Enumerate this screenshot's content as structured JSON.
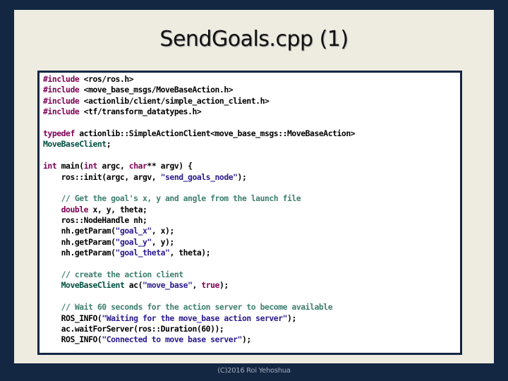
{
  "slide": {
    "title": "SendGoals.cpp (1)",
    "footer": "(C)2016 Roi Yehoshua"
  },
  "colors": {
    "frame_background": "#132642",
    "panel_background": "#eeebe1",
    "code_background": "#ffffff",
    "keyword": "#7f0055",
    "string": "#2a1a90",
    "comment": "#3f7f6f",
    "type_name": "#005040"
  },
  "code": {
    "language": "C++",
    "lines": [
      [
        {
          "t": "kw",
          "s": "#include"
        },
        {
          "t": "plain",
          "s": " <ros/ros.h>"
        }
      ],
      [
        {
          "t": "kw",
          "s": "#include"
        },
        {
          "t": "plain",
          "s": " <move_base_msgs/MoveBaseAction.h>"
        }
      ],
      [
        {
          "t": "kw",
          "s": "#include"
        },
        {
          "t": "plain",
          "s": " <actionlib/client/simple_action_client.h>"
        }
      ],
      [
        {
          "t": "kw",
          "s": "#include"
        },
        {
          "t": "plain",
          "s": " <tf/transform_datatypes.h>"
        }
      ],
      [],
      [
        {
          "t": "kw",
          "s": "typedef"
        },
        {
          "t": "plain",
          "s": " actionlib::SimpleActionClient<move_base_msgs::MoveBaseAction>"
        }
      ],
      [
        {
          "t": "type",
          "s": "MoveBaseClient"
        },
        {
          "t": "plain",
          "s": ";"
        }
      ],
      [],
      [
        {
          "t": "kw",
          "s": "int"
        },
        {
          "t": "plain",
          "s": " main("
        },
        {
          "t": "kw",
          "s": "int"
        },
        {
          "t": "plain",
          "s": " argc, "
        },
        {
          "t": "kw",
          "s": "char"
        },
        {
          "t": "plain",
          "s": "** argv) {"
        }
      ],
      [
        {
          "t": "plain",
          "s": "    ros::init(argc, argv, "
        },
        {
          "t": "str",
          "s": "\"send_goals_node\""
        },
        {
          "t": "plain",
          "s": ");"
        }
      ],
      [],
      [
        {
          "t": "cmt",
          "s": "    // Get the goal's x, y and angle from the launch file"
        }
      ],
      [
        {
          "t": "plain",
          "s": "    "
        },
        {
          "t": "kw",
          "s": "double"
        },
        {
          "t": "plain",
          "s": " x, y, theta;"
        }
      ],
      [
        {
          "t": "plain",
          "s": "    ros::NodeHandle nh;"
        }
      ],
      [
        {
          "t": "plain",
          "s": "    nh.getParam("
        },
        {
          "t": "str",
          "s": "\"goal_x\""
        },
        {
          "t": "plain",
          "s": ", x);"
        }
      ],
      [
        {
          "t": "plain",
          "s": "    nh.getParam("
        },
        {
          "t": "str",
          "s": "\"goal_y\""
        },
        {
          "t": "plain",
          "s": ", y);"
        }
      ],
      [
        {
          "t": "plain",
          "s": "    nh.getParam("
        },
        {
          "t": "str",
          "s": "\"goal_theta\""
        },
        {
          "t": "plain",
          "s": ", theta);"
        }
      ],
      [],
      [
        {
          "t": "cmt",
          "s": "    // create the action client"
        }
      ],
      [
        {
          "t": "plain",
          "s": "    "
        },
        {
          "t": "type",
          "s": "MoveBaseClient"
        },
        {
          "t": "plain",
          "s": " ac("
        },
        {
          "t": "str",
          "s": "\"move_base\""
        },
        {
          "t": "plain",
          "s": ", "
        },
        {
          "t": "kw",
          "s": "true"
        },
        {
          "t": "plain",
          "s": ");"
        }
      ],
      [],
      [
        {
          "t": "cmt",
          "s": "    // Wait 60 seconds for the action server to become available"
        }
      ],
      [
        {
          "t": "plain",
          "s": "    ROS_INFO("
        },
        {
          "t": "str",
          "s": "\"Waiting for the move_base action server\""
        },
        {
          "t": "plain",
          "s": ");"
        }
      ],
      [
        {
          "t": "plain",
          "s": "    ac.waitForServer(ros::Duration(60));"
        }
      ],
      [
        {
          "t": "plain",
          "s": "    ROS_INFO("
        },
        {
          "t": "str",
          "s": "\"Connected to move base server\""
        },
        {
          "t": "plain",
          "s": ");"
        }
      ]
    ]
  }
}
